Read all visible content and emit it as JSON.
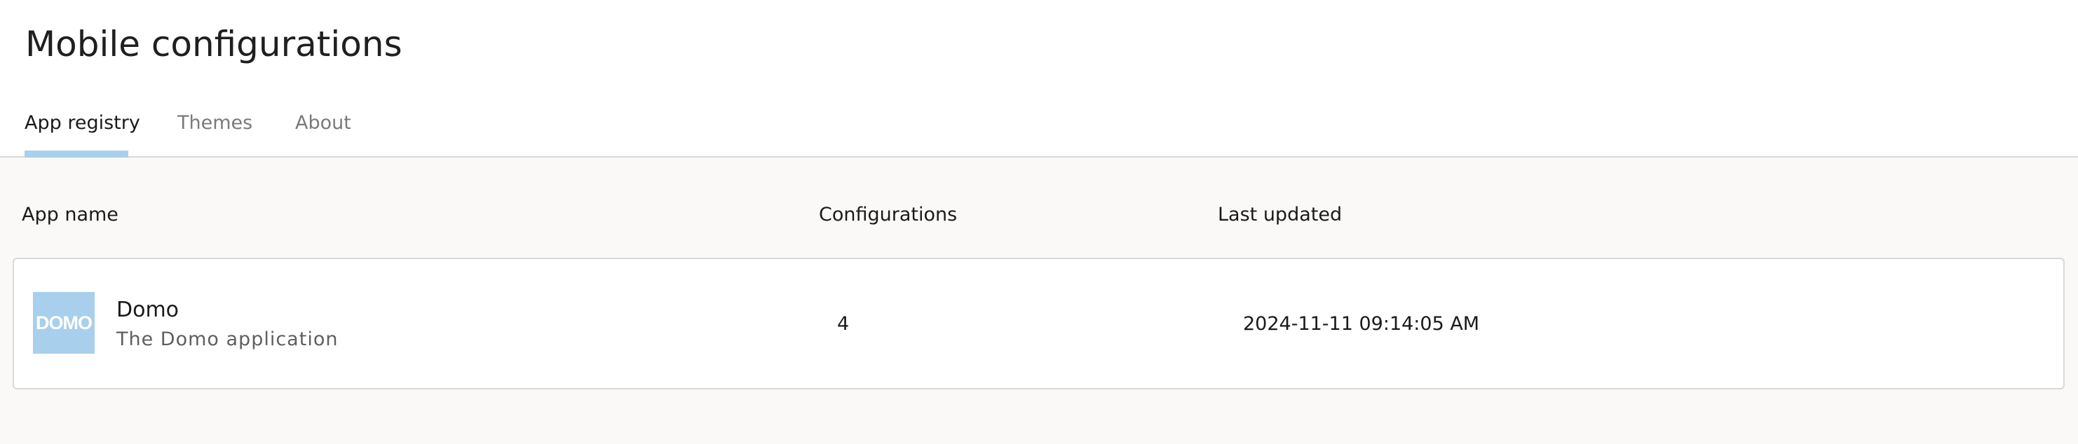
{
  "page": {
    "title": "Mobile configurations"
  },
  "tabs": [
    {
      "label": "App registry",
      "active": true
    },
    {
      "label": "Themes",
      "active": false
    },
    {
      "label": "About",
      "active": false
    }
  ],
  "table": {
    "columns": [
      "App name",
      "Configurations",
      "Last updated"
    ],
    "rows": [
      {
        "logo_text": "DOMO",
        "name": "Domo",
        "description": "The Domo application",
        "configurations": "4",
        "last_updated": "2024-11-11 09:14:05 AM"
      }
    ]
  },
  "colors": {
    "accent": "#a8cfeb",
    "content_background": "#faf9f8",
    "border": "#d9d9d9"
  }
}
